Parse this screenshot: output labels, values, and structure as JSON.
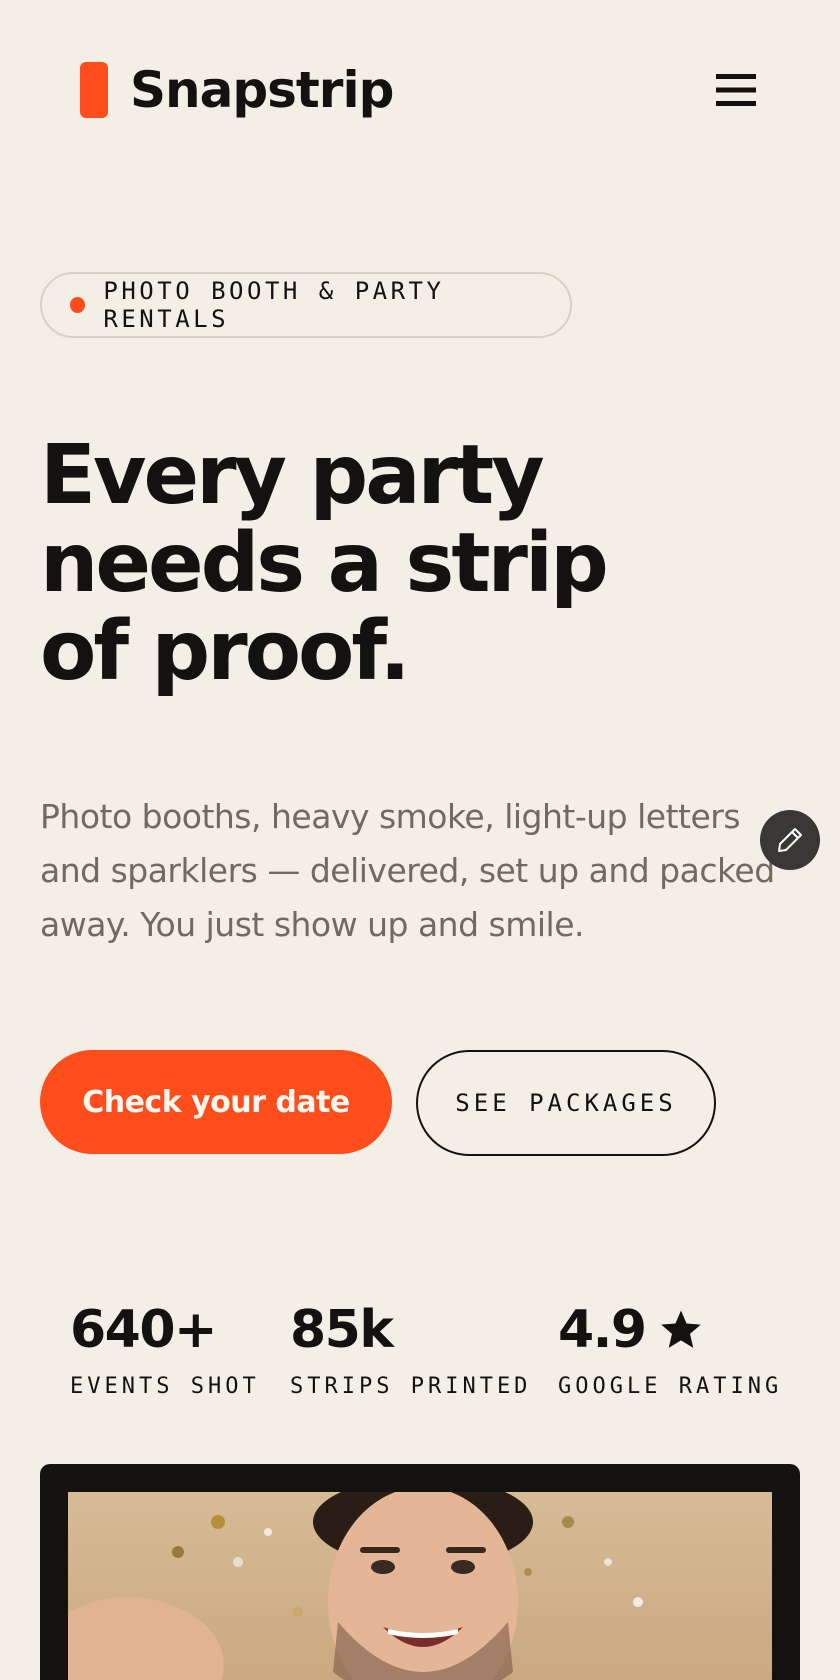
{
  "header": {
    "brand_name": "Snapstrip",
    "brand_color": "#ff4d1c",
    "menu_icon": "hamburger-menu-icon"
  },
  "hero": {
    "badge_text": "PHOTO BOOTH & PARTY RENTALS",
    "headline_lines": [
      "Every party",
      "needs a strip",
      "of proof."
    ],
    "subtext": "Photo booths, heavy smoke, light-up letters and sparklers — delivered, set up and packed away. You just show up and smile."
  },
  "cta": {
    "primary_label": "Check your date",
    "secondary_label": "SEE PACKAGES"
  },
  "stats": [
    {
      "value": "640+",
      "label": "EVENTS SHOT"
    },
    {
      "value": "85k",
      "label": "STRIPS PRINTED"
    },
    {
      "value": "4.9",
      "label": "GOOGLE RATING",
      "icon": "star-icon"
    }
  ],
  "floating_action": {
    "icon": "pencil-icon"
  },
  "photo": {
    "subject": "smiling-man-confetti-photo"
  },
  "colors": {
    "background": "#f3efe6",
    "accent": "#ff4d1c",
    "text": "#141210",
    "muted_text": "#716a60"
  }
}
